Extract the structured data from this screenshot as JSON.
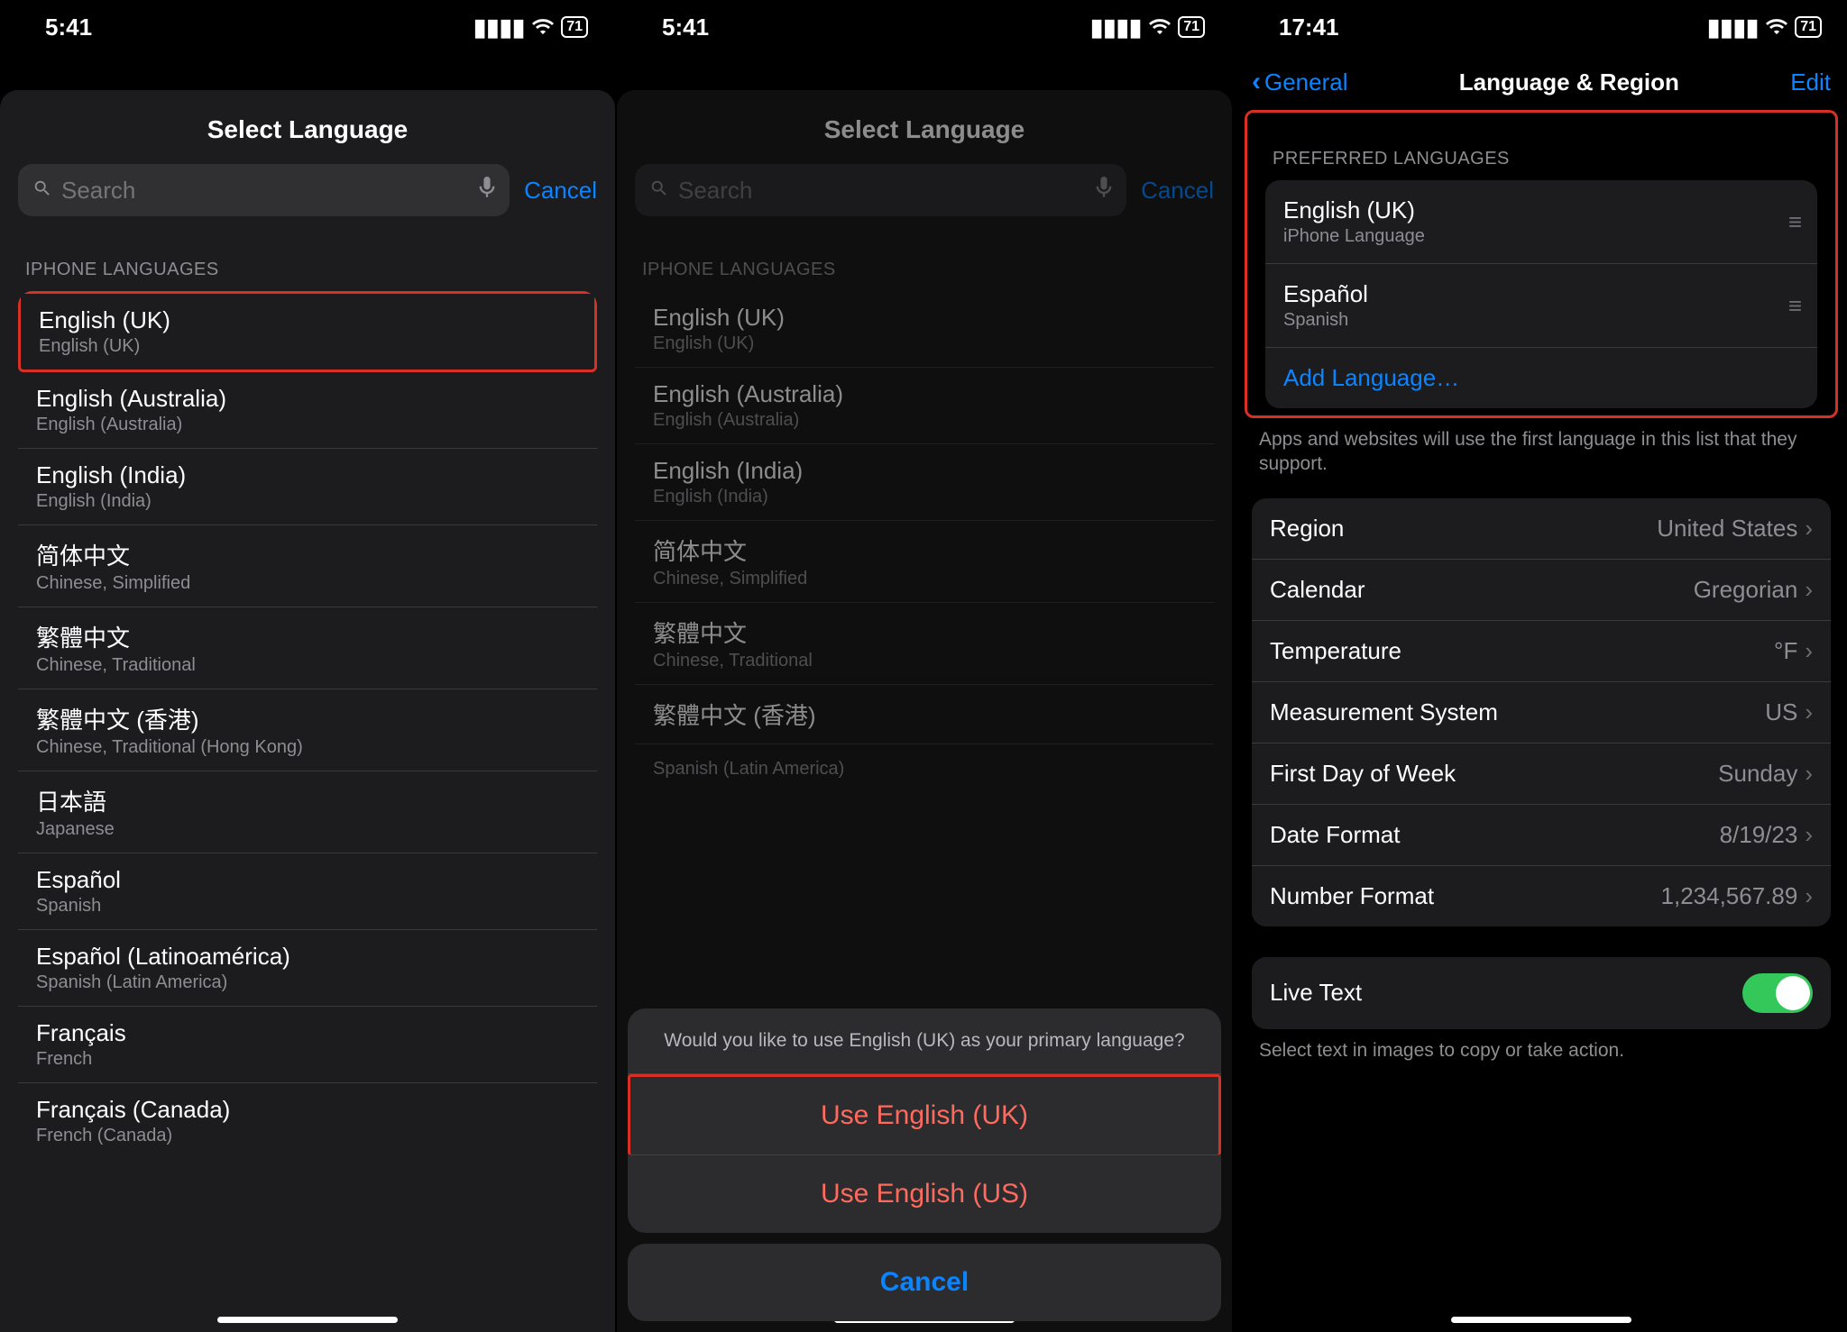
{
  "status": {
    "time_12": "5:41",
    "time_24": "17:41",
    "battery": "71"
  },
  "panel1": {
    "title": "Select Language",
    "search_placeholder": "Search",
    "cancel": "Cancel",
    "section": "IPHONE LANGUAGES",
    "langs": [
      {
        "name": "English (UK)",
        "sub": "English (UK)",
        "hl": true
      },
      {
        "name": "English (Australia)",
        "sub": "English (Australia)"
      },
      {
        "name": "English (India)",
        "sub": "English (India)"
      },
      {
        "name": "简体中文",
        "sub": "Chinese, Simplified"
      },
      {
        "name": "繁體中文",
        "sub": "Chinese, Traditional"
      },
      {
        "name": "繁體中文 (香港)",
        "sub": "Chinese, Traditional (Hong Kong)"
      },
      {
        "name": "日本語",
        "sub": "Japanese"
      },
      {
        "name": "Español",
        "sub": "Spanish"
      },
      {
        "name": "Español (Latinoamérica)",
        "sub": "Spanish (Latin America)"
      },
      {
        "name": "Français",
        "sub": "French"
      },
      {
        "name": "Français (Canada)",
        "sub": "French (Canada)"
      }
    ]
  },
  "panel2": {
    "title": "Select Language",
    "search_placeholder": "Search",
    "cancel": "Cancel",
    "section": "IPHONE LANGUAGES",
    "langs": [
      {
        "name": "English (UK)",
        "sub": "English (UK)"
      },
      {
        "name": "English (Australia)",
        "sub": "English (Australia)"
      },
      {
        "name": "English (India)",
        "sub": "English (India)"
      },
      {
        "name": "简体中文",
        "sub": "Chinese, Simplified"
      },
      {
        "name": "繁體中文",
        "sub": "Chinese, Traditional"
      },
      {
        "name": "繁體中文 (香港)",
        "sub": ""
      },
      {
        "name": "",
        "sub": "Spanish (Latin America)"
      }
    ],
    "sheet": {
      "message": "Would you like to use English (UK) as your primary language?",
      "use_uk": "Use English (UK)",
      "use_us": "Use English (US)",
      "cancel": "Cancel"
    }
  },
  "panel3": {
    "back": "General",
    "title": "Language & Region",
    "edit": "Edit",
    "pref_header": "PREFERRED LANGUAGES",
    "pref_langs": [
      {
        "name": "English (UK)",
        "sub": "iPhone Language"
      },
      {
        "name": "Español",
        "sub": "Spanish"
      }
    ],
    "add_language": "Add Language…",
    "pref_footer": "Apps and websites will use the first language in this list that they support.",
    "settings": [
      {
        "label": "Region",
        "value": "United States"
      },
      {
        "label": "Calendar",
        "value": "Gregorian"
      },
      {
        "label": "Temperature",
        "value": "°F"
      },
      {
        "label": "Measurement System",
        "value": "US"
      },
      {
        "label": "First Day of Week",
        "value": "Sunday"
      },
      {
        "label": "Date Format",
        "value": "8/19/23"
      },
      {
        "label": "Number Format",
        "value": "1,234,567.89"
      }
    ],
    "live_text_label": "Live Text",
    "live_text_footer": "Select text in images to copy or take action."
  }
}
